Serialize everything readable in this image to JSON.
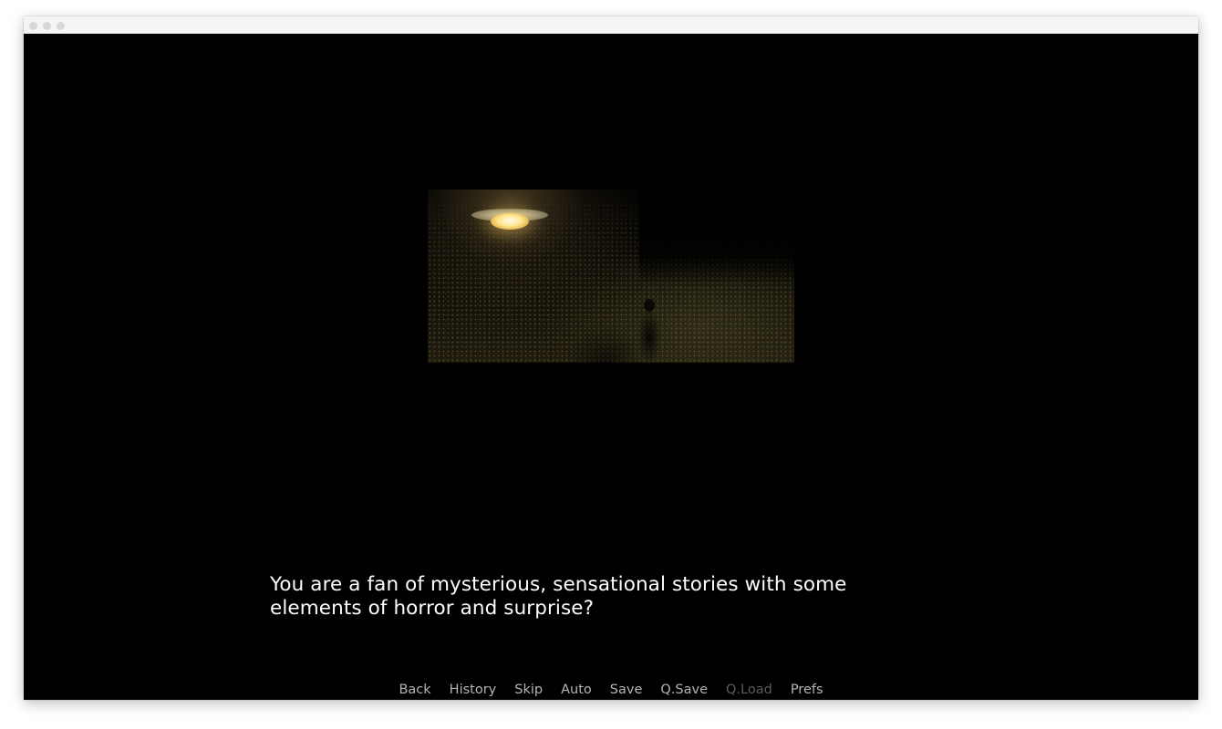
{
  "window": {
    "controls": [
      "close",
      "minimize",
      "maximize"
    ]
  },
  "scene": {
    "description_icon": "street-lamp-night-scene"
  },
  "dialogue": {
    "line1": "You are a fan of mysterious, sensational stories with some",
    "line2": "elements of horror and surprise?"
  },
  "quick_menu": {
    "back": "Back",
    "history": "History",
    "skip": "Skip",
    "auto": "Auto",
    "save": "Save",
    "qsave": "Q.Save",
    "qload": "Q.Load",
    "prefs": "Prefs"
  },
  "colors": {
    "background": "#000000",
    "text": "#ffffff",
    "menu_text": "#b4b4b4",
    "menu_disabled": "#5c5c5c"
  }
}
